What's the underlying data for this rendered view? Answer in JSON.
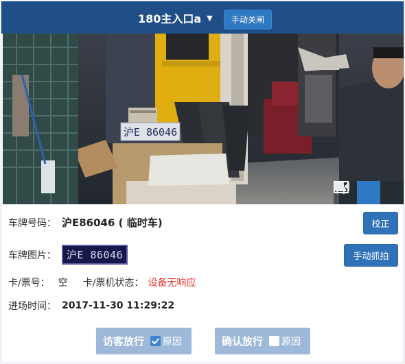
{
  "header": {
    "title": "180主入口a",
    "caret": "▼",
    "gate_button": "手动关闸"
  },
  "camera": {
    "plate_text": "沪E 86046",
    "toolbar": [
      "seat-icon",
      "image-icon",
      "video-icon"
    ],
    "active_tool": "image-icon"
  },
  "info": {
    "plate_label": "车牌号码：",
    "plate_value": "沪E86046 ( 临时车)",
    "correct_button": "校正",
    "plate_image_label": "车牌图片：",
    "plate_image_text": "沪E 86046",
    "capture_button": "手动抓拍",
    "card_label": "卡/票号：",
    "card_value": "空",
    "card_status_label": "卡/票机状态：",
    "card_status_value": "设备无响应",
    "entry_label": "进场时间：",
    "entry_value": "2017-11-30 11:29:22"
  },
  "actions": {
    "visitor_release": "访客放行",
    "visitor_reason": "原因",
    "visitor_reason_checked": true,
    "confirm_release": "确认放行",
    "confirm_reason": "原因",
    "confirm_reason_checked": false
  },
  "colors": {
    "header": "#1f4f86",
    "button": "#2f72b8",
    "error": "#e53935",
    "release": "#9db8d8"
  }
}
